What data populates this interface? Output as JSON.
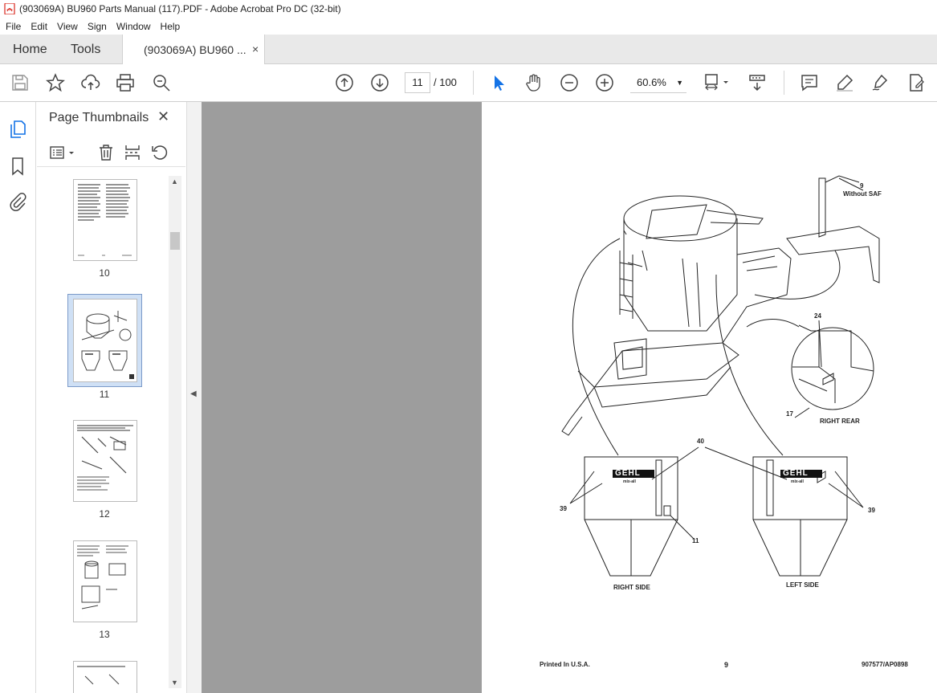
{
  "window": {
    "title": "(903069A) BU960 Parts Manual (117).PDF - Adobe Acrobat Pro DC (32-bit)"
  },
  "menu": [
    "File",
    "Edit",
    "View",
    "Sign",
    "Window",
    "Help"
  ],
  "tabs": {
    "home": "Home",
    "tools": "Tools",
    "doc": "(903069A) BU960 ...",
    "close": "×"
  },
  "toolbar": {
    "page_current": "11",
    "page_total": "/ 100",
    "zoom": "60.6%"
  },
  "thumbnails": {
    "title": "Page Thumbnails",
    "close": "✕",
    "pages": [
      "10",
      "11",
      "12",
      "13"
    ]
  },
  "document": {
    "callouts": {
      "c9": "9",
      "without_saf": "Without SAF",
      "c24": "24",
      "c17": "17",
      "right_rear": "RIGHT REAR",
      "c40": "40",
      "c39_left": "39",
      "c39_right": "39",
      "c11": "11",
      "right_side": "RIGHT SIDE",
      "left_side": "LEFT SIDE",
      "logo": "GEHL",
      "logo_sub": "mix-all"
    },
    "footer": {
      "printed": "Printed In U.S.A.",
      "page_no": "9",
      "code": "907577/AP0898"
    }
  },
  "colors": {
    "accent": "#1473e6",
    "pdf_red": "#d9261c",
    "workspace_gray": "#9d9d9d"
  }
}
